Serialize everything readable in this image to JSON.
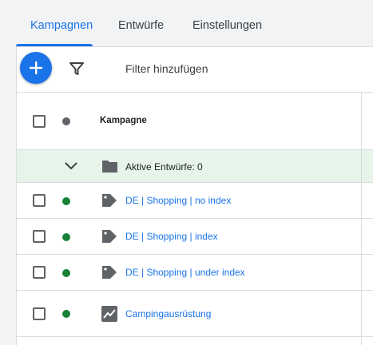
{
  "tabs": [
    {
      "label": "Kampagnen",
      "active": true
    },
    {
      "label": "Entwürfe",
      "active": false
    },
    {
      "label": "Einstellungen",
      "active": false
    }
  ],
  "toolbar": {
    "add_icon": "plus-icon",
    "filter_icon": "funnel-icon",
    "filter_label": "Filter hinzufügen"
  },
  "table": {
    "header": {
      "column_label": "Kampagne"
    },
    "draft_group": {
      "label": "Aktive Entwürfe: 0"
    },
    "rows": [
      {
        "name": "DE | Shopping | no index",
        "status": "enabled",
        "type_icon": "tag-icon"
      },
      {
        "name": "DE | Shopping | index",
        "status": "enabled",
        "type_icon": "tag-icon"
      },
      {
        "name": "DE | Shopping | under index",
        "status": "enabled",
        "type_icon": "tag-icon"
      },
      {
        "name": "Campingausrüstung",
        "status": "enabled",
        "type_icon": "trending-chart-icon"
      }
    ]
  },
  "colors": {
    "accent": "#1a73e8",
    "status_enabled": "#188038",
    "draft_row_bg": "#e6f4ea"
  }
}
